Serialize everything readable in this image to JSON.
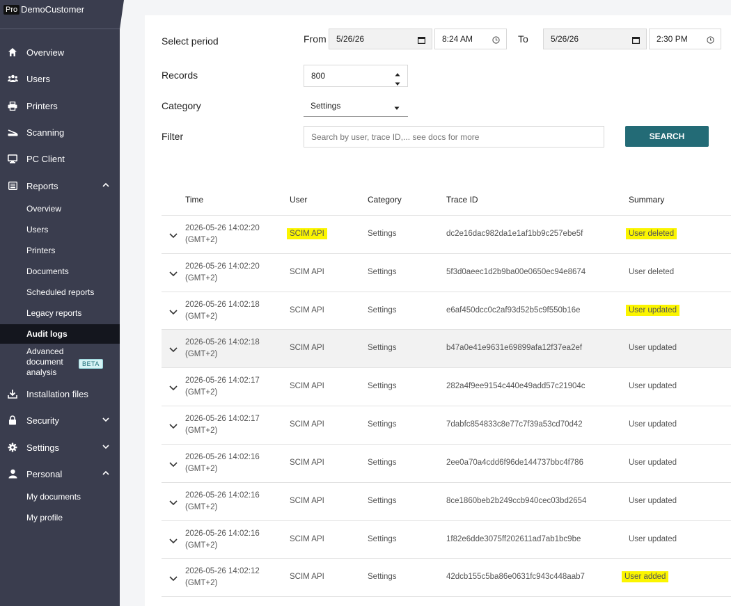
{
  "sidebar": {
    "brand_badge": "Pro",
    "brand_name": "DemoCustomer",
    "items": {
      "overview": "Overview",
      "users": "Users",
      "printers": "Printers",
      "scanning": "Scanning",
      "pc_client": "PC Client",
      "reports": "Reports",
      "installation_files": "Installation files",
      "security": "Security",
      "settings": "Settings",
      "personal": "Personal"
    },
    "reports_sub": {
      "overview": "Overview",
      "users": "Users",
      "printers": "Printers",
      "documents": "Documents",
      "scheduled_reports": "Scheduled reports",
      "legacy_reports": "Legacy reports",
      "audit_logs": "Audit logs",
      "advanced": "Advanced document analysis",
      "beta": "BETA"
    },
    "personal_sub": {
      "my_documents": "My documents",
      "my_profile": "My profile"
    }
  },
  "filters": {
    "select_period_label": "Select period",
    "from_label": "From",
    "from_date": "5/26/26",
    "from_time": "8:24 AM",
    "to_label": "To",
    "to_date": "5/26/26",
    "to_time": "2:30 PM",
    "records_label": "Records",
    "records_value": "800",
    "category_label": "Category",
    "category_value": "Settings",
    "filter_label": "Filter",
    "filter_placeholder": "Search by user, trace ID,... see docs for more",
    "search_button": "SEARCH"
  },
  "table": {
    "headers": {
      "time": "Time",
      "user": "User",
      "category": "Category",
      "trace_id": "Trace ID",
      "summary": "Summary"
    },
    "rows": [
      {
        "time": "2026-05-26 14:02:20",
        "tz": "(GMT+2)",
        "user": "SCIM API",
        "category": "Settings",
        "trace_id": "dc2e16dac982da1e1af1bb9c257ebe5f",
        "summary": "User deleted"
      },
      {
        "time": "2026-05-26 14:02:20",
        "tz": "(GMT+2)",
        "user": "SCIM API",
        "category": "Settings",
        "trace_id": "5f3d0aeec1d2b9ba00e0650ec94e8674",
        "summary": "User deleted"
      },
      {
        "time": "2026-05-26 14:02:18",
        "tz": "(GMT+2)",
        "user": "SCIM API",
        "category": "Settings",
        "trace_id": "e6af450dcc0c2af93d52b5c9f550b16e",
        "summary": "User updated"
      },
      {
        "time": "2026-05-26 14:02:18",
        "tz": "(GMT+2)",
        "user": "SCIM API",
        "category": "Settings",
        "trace_id": "b47a0e41e9631e69899afa12f37ea2ef",
        "summary": "User updated"
      },
      {
        "time": "2026-05-26 14:02:17",
        "tz": "(GMT+2)",
        "user": "SCIM API",
        "category": "Settings",
        "trace_id": "282a4f9ee9154c440e49add57c21904c",
        "summary": "User updated"
      },
      {
        "time": "2026-05-26 14:02:17",
        "tz": "(GMT+2)",
        "user": "SCIM API",
        "category": "Settings",
        "trace_id": "7dabfc854833c8e77c7f39a53cd70d42",
        "summary": "User updated"
      },
      {
        "time": "2026-05-26 14:02:16",
        "tz": "(GMT+2)",
        "user": "SCIM API",
        "category": "Settings",
        "trace_id": "2ee0a70a4cdd6f96de144737bbc4f786",
        "summary": "User updated"
      },
      {
        "time": "2026-05-26 14:02:16",
        "tz": "(GMT+2)",
        "user": "SCIM API",
        "category": "Settings",
        "trace_id": "8ce1860beb2b249ccb940cec03bd2654",
        "summary": "User updated"
      },
      {
        "time": "2026-05-26 14:02:16",
        "tz": "(GMT+2)",
        "user": "SCIM API",
        "category": "Settings",
        "trace_id": "1f82e6dde3075ff202611ad7ab1bc9be",
        "summary": "User updated"
      },
      {
        "time": "2026-05-26 14:02:12",
        "tz": "(GMT+2)",
        "user": "SCIM API",
        "category": "Settings",
        "trace_id": "42dcb155c5ba86e0631fc943c448aab7",
        "summary": "User added"
      }
    ]
  },
  "colors": {
    "sidebar": "#3a3d4e",
    "active_item": "#14161e",
    "accent": "#236b76",
    "highlight": "#fbf500"
  }
}
